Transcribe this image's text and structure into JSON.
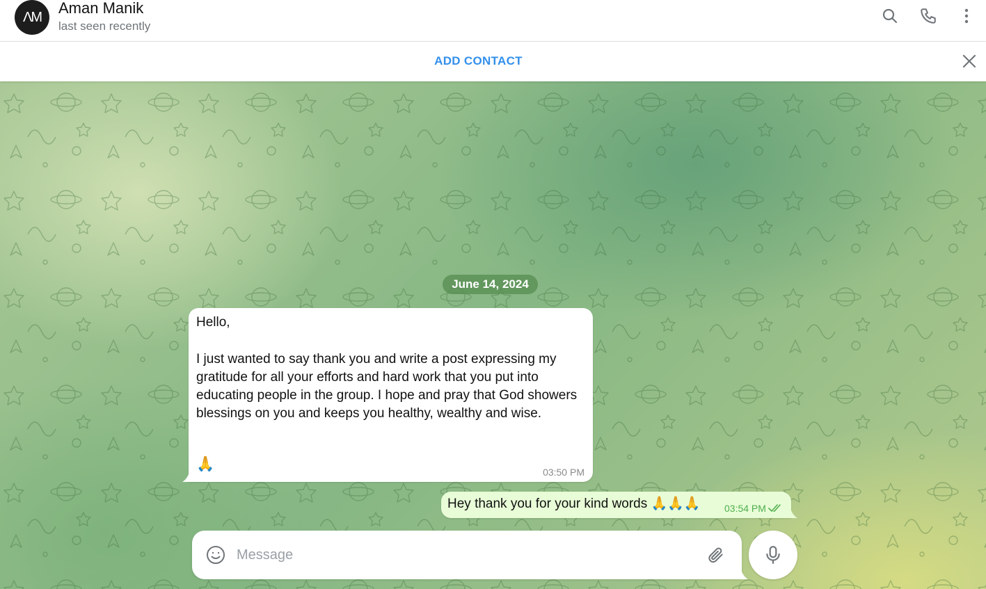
{
  "header": {
    "avatar_text": "ΛM",
    "contact_name": "Aman Manik",
    "status": "last seen recently",
    "icons": [
      "search-icon",
      "phone-icon",
      "more-vertical-icon"
    ]
  },
  "banner": {
    "add_contact_label": "ADD CONTACT",
    "close_icon": "close-icon"
  },
  "chat": {
    "date_label": "June 14, 2024",
    "messages": [
      {
        "direction": "incoming",
        "text": "Hello,\n\nI just wanted to say thank you and write a post expressing my gratitude for all your efforts and hard work that you put into educating people in the group. I hope and pray that God showers blessings on you and keeps you healthy, wealthy and wise.",
        "emoji": "🙏",
        "time": "03:50 PM"
      },
      {
        "direction": "outgoing",
        "text": "Hey thank you for your kind words 🙏🙏🙏",
        "time": "03:54 PM",
        "status_icon": "double-check-icon"
      }
    ]
  },
  "composer": {
    "placeholder": "Message",
    "value": "",
    "icons": [
      "emoji-icon",
      "attach-icon",
      "mic-icon"
    ]
  },
  "colors": {
    "accent": "#3390ec",
    "outgoing_bubble": "#e8fdd7",
    "read_check": "#4fae4e",
    "date_pill": "#5a8c50"
  }
}
